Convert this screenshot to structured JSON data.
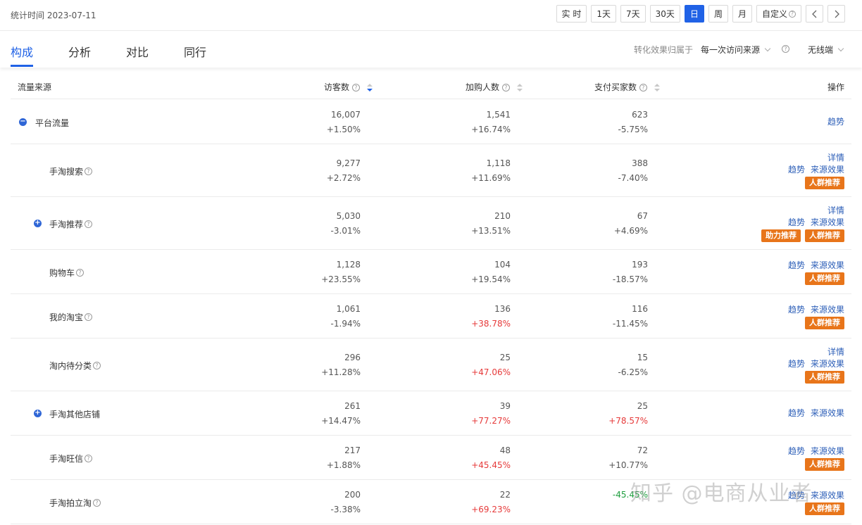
{
  "header": {
    "stat_date": "统计时间 2023-07-11",
    "periods": [
      "实 时",
      "1天",
      "7天",
      "30天",
      "日",
      "周",
      "月",
      "自定义"
    ],
    "active_period": "日",
    "prev_icon": "chevron-left-icon",
    "next_icon": "chevron-right-icon"
  },
  "tabs": [
    "构成",
    "分析",
    "对比",
    "同行"
  ],
  "active_tab": "构成",
  "attribution": {
    "label": "转化效果归属于",
    "value": "每一次访问来源",
    "device": "无线端"
  },
  "table": {
    "columns": {
      "source": "流量来源",
      "visitors": "访客数",
      "cart": "加购人数",
      "buyers": "支付买家数",
      "ops": "操作"
    },
    "rows": [
      {
        "source": "平台流量",
        "visitors": "16,007",
        "visitors_chg": "+1.50%",
        "cart": "1,541",
        "cart_chg": "+16.74%",
        "buyers": "623",
        "buyers_chg": "-5.75%",
        "ops": [
          [
            "趋势"
          ]
        ]
      },
      {
        "source": "手淘搜索",
        "visitors": "9,277",
        "visitors_chg": "+2.72%",
        "cart": "1,118",
        "cart_chg": "+11.69%",
        "buyers": "388",
        "buyers_chg": "-7.40%",
        "ops": [
          [
            "详情"
          ],
          [
            "趋势",
            "来源效果"
          ]
        ],
        "tags": [
          "人群推荐"
        ]
      },
      {
        "source": "手淘推荐",
        "visitors": "5,030",
        "visitors_chg": "-3.01%",
        "cart": "210",
        "cart_chg": "+13.51%",
        "buyers": "67",
        "buyers_chg": "+4.69%",
        "ops": [
          [
            "详情"
          ],
          [
            "趋势",
            "来源效果"
          ]
        ],
        "tags": [
          "助力推荐",
          "人群推荐"
        ]
      },
      {
        "source": "购物车",
        "visitors": "1,128",
        "visitors_chg": "+23.55%",
        "cart": "104",
        "cart_chg": "+19.54%",
        "buyers": "193",
        "buyers_chg": "-18.57%",
        "ops": [
          [
            "趋势",
            "来源效果"
          ]
        ],
        "tags": [
          "人群推荐"
        ]
      },
      {
        "source": "我的淘宝",
        "visitors": "1,061",
        "visitors_chg": "-1.94%",
        "cart": "136",
        "cart_chg": "+38.78%",
        "buyers": "116",
        "buyers_chg": "-11.45%",
        "ops": [
          [
            "趋势",
            "来源效果"
          ]
        ],
        "tags": [
          "人群推荐"
        ]
      },
      {
        "source": "淘内待分类",
        "visitors": "296",
        "visitors_chg": "+11.28%",
        "cart": "25",
        "cart_chg": "+47.06%",
        "buyers": "15",
        "buyers_chg": "-6.25%",
        "ops": [
          [
            "详情"
          ],
          [
            "趋势",
            "来源效果"
          ]
        ],
        "tags": [
          "人群推荐"
        ]
      },
      {
        "source": "手淘其他店铺",
        "visitors": "261",
        "visitors_chg": "+14.47%",
        "cart": "39",
        "cart_chg": "+77.27%",
        "buyers": "25",
        "buyers_chg": "+78.57%",
        "ops": [
          [
            "趋势",
            "来源效果"
          ]
        ]
      },
      {
        "source": "手淘旺信",
        "visitors": "217",
        "visitors_chg": "+1.88%",
        "cart": "48",
        "cart_chg": "+45.45%",
        "buyers": "72",
        "buyers_chg": "+10.77%",
        "ops": [
          [
            "趋势",
            "来源效果"
          ]
        ],
        "tags": [
          "人群推荐"
        ]
      },
      {
        "source": "手淘拍立淘",
        "visitors": "200",
        "visitors_chg": "-3.38%",
        "cart": "22",
        "cart_chg": "+69.23%",
        "buyers": "",
        "buyers_chg": "-45.45%",
        "ops": [
          [
            "趋势",
            "来源效果"
          ]
        ],
        "tags": [
          "人群推荐"
        ]
      }
    ]
  },
  "watermark": "知乎 @电商从业者",
  "colors": {
    "accent": "#2062e6",
    "tag": "#e8751a",
    "up_red": "#e63a3a",
    "down_green": "#1e9e3e",
    "link": "#2d5fb8"
  }
}
